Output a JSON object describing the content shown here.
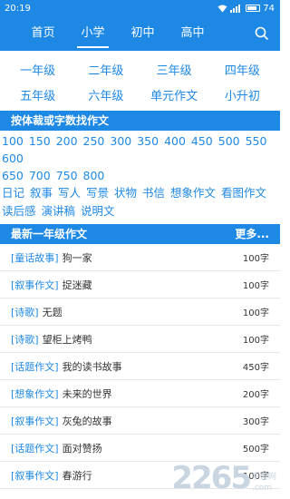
{
  "status": {
    "time": "20:19",
    "battery": "74"
  },
  "nav": {
    "tabs": [
      "首页",
      "小学",
      "初中",
      "高中"
    ],
    "active": 1,
    "search_icon": "search-icon"
  },
  "grades": {
    "row1": [
      "一年级",
      "二年级",
      "三年级",
      "四年级"
    ],
    "row2": [
      "五年级",
      "六年级",
      "单元作文",
      "小升初"
    ]
  },
  "filter_section": {
    "title": "按体裁或字数找作文"
  },
  "word_counts": [
    "100",
    "150",
    "200",
    "250",
    "300",
    "350",
    "400",
    "450",
    "500",
    "550",
    "600",
    "650",
    "700",
    "750",
    "800"
  ],
  "genres": [
    "日记",
    "叙事",
    "写人",
    "写景",
    "状物",
    "书信",
    "想象作文",
    "看图作文",
    "读后感",
    "演讲稿",
    "说明文"
  ],
  "latest_section": {
    "title": "最新一年级作文",
    "more": "更多..."
  },
  "articles": [
    {
      "tag": "[童话故事]",
      "title": "狗一家",
      "count": "100字"
    },
    {
      "tag": "[叙事作文]",
      "title": "捉迷藏",
      "count": "100字"
    },
    {
      "tag": "[诗歌]",
      "title": "无题",
      "count": "100字"
    },
    {
      "tag": "[诗歌]",
      "title": "望柜上烤鸭",
      "count": "100字"
    },
    {
      "tag": "[话题作文]",
      "title": "我的读书故事",
      "count": "450字"
    },
    {
      "tag": "[想象作文]",
      "title": "未来的世界",
      "count": "200字"
    },
    {
      "tag": "[叙事作文]",
      "title": "灰兔的故事",
      "count": "300字"
    },
    {
      "tag": "[话题作文]",
      "title": "面对赞扬",
      "count": "500字"
    },
    {
      "tag": "[叙事作文]",
      "title": "春游行",
      "count": "100字"
    }
  ],
  "watermark": {
    "number": "2265",
    "site": "手游网",
    "domain": ".com"
  }
}
